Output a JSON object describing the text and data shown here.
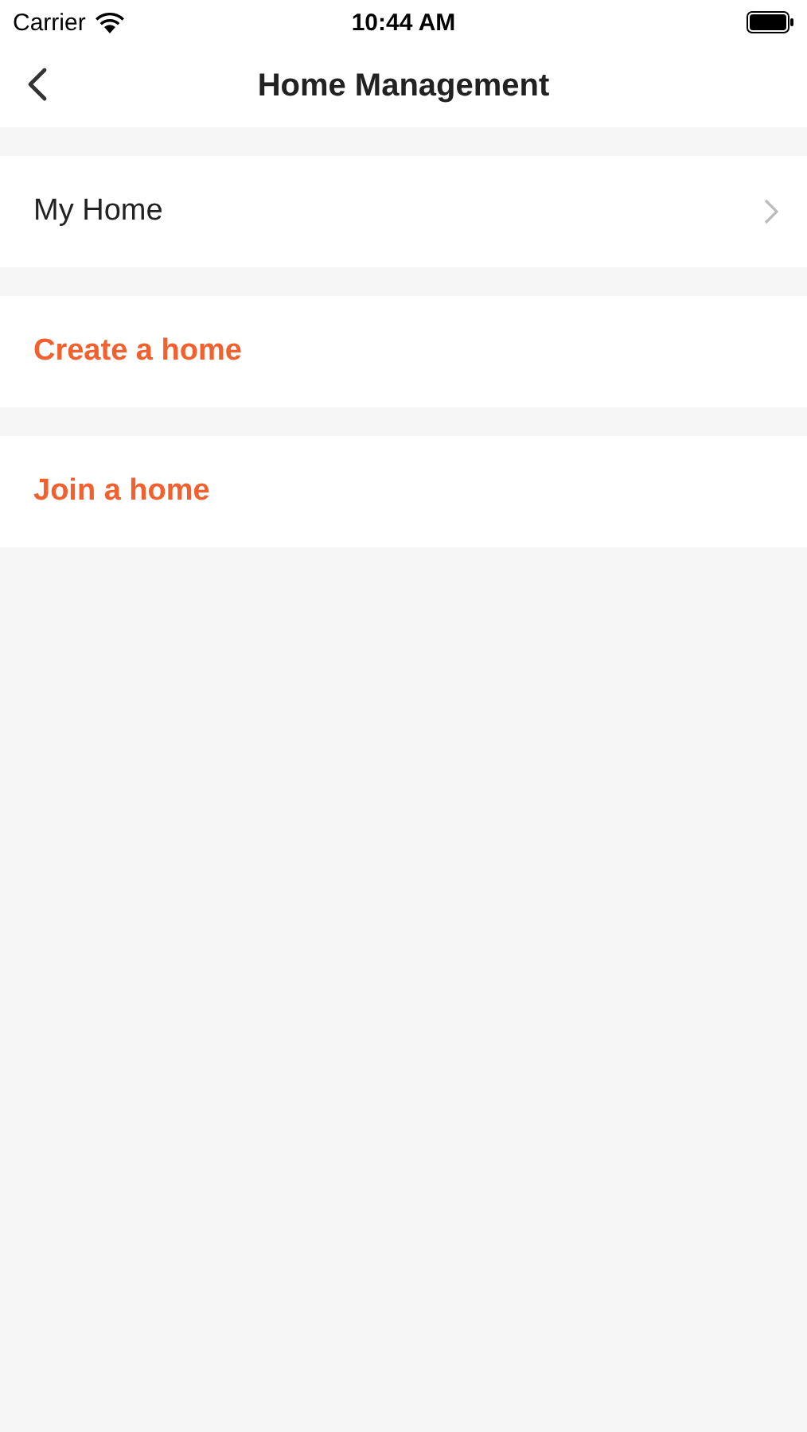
{
  "status_bar": {
    "carrier": "Carrier",
    "time": "10:44 AM"
  },
  "nav": {
    "title": "Home Management"
  },
  "items": [
    {
      "label": "My Home",
      "kind": "link"
    },
    {
      "label": "Create a home",
      "kind": "action"
    },
    {
      "label": "Join a home",
      "kind": "action"
    }
  ]
}
